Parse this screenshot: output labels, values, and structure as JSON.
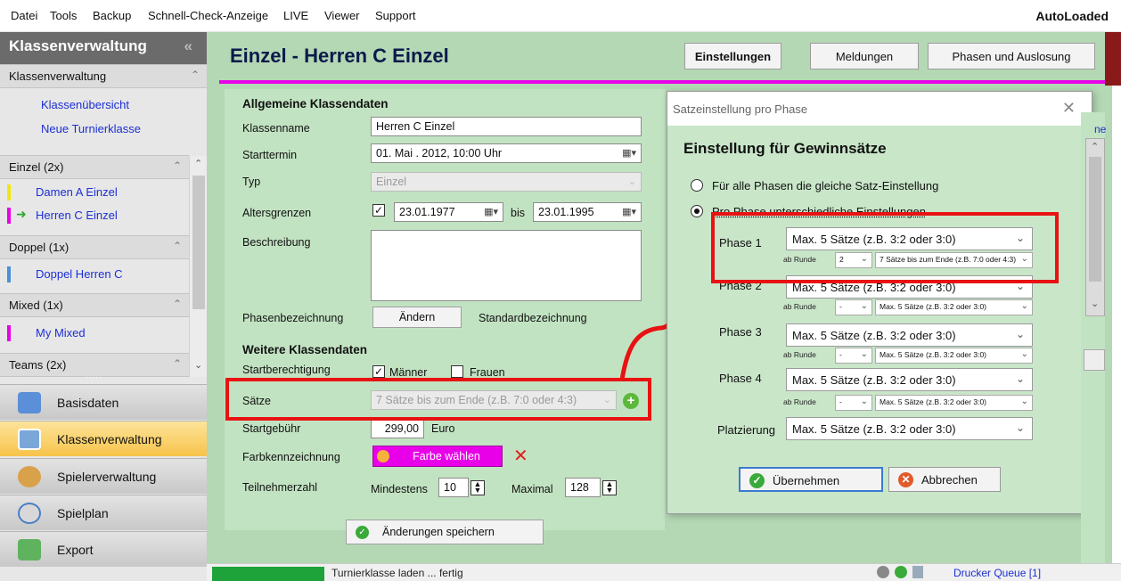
{
  "menu": [
    "Datei",
    "Tools",
    "Backup",
    "Schnell-Check-Anzeige",
    "LIVE",
    "Viewer",
    "Support"
  ],
  "autoloaded": "AutoLoaded",
  "sidebar": {
    "header": "Klassenverwaltung",
    "collapse": "«",
    "sections": [
      {
        "label": "Klassenverwaltung",
        "items": [
          "Klassenübersicht",
          "Neue Turnierklasse"
        ]
      },
      {
        "label": "Einzel (2x)",
        "items": [
          "Damen A Einzel",
          "Herren C Einzel"
        ]
      },
      {
        "label": "Doppel (1x)",
        "items": [
          "Doppel Herren C"
        ]
      },
      {
        "label": "Mixed (1x)",
        "items": [
          "My Mixed"
        ]
      },
      {
        "label": "Teams (2x)",
        "items": []
      }
    ],
    "dots": ".....",
    "nav": [
      "Basisdaten",
      "Klassenverwaltung",
      "Spielerverwaltung",
      "Spielplan",
      "Export"
    ],
    "colors": {
      "damen": "#f0e80c",
      "herren": "#e800e8",
      "doppel": "#4a90d9",
      "mixed": "#e800e8",
      "active_nav": "#fbd66b"
    }
  },
  "main": {
    "title": "Einzel - Herren C Einzel",
    "tabs": [
      "Einstellungen",
      "Meldungen",
      "Phasen und Auslosung"
    ]
  },
  "form": {
    "general_title": "Allgemeine Klassendaten",
    "labels": {
      "klassenname": "Klassenname",
      "starttermin": "Starttermin",
      "typ": "Typ",
      "alter": "Altersgrenzen",
      "bis": "bis",
      "beschreibung": "Beschreibung",
      "phasen": "Phasenbezeichnung",
      "standard": "Standardbezeichnung"
    },
    "values": {
      "klassenname": "Herren C Einzel",
      "starttermin": "01. Mai . 2012, 10:00 Uhr",
      "typ": "Einzel",
      "alter_von": "23.01.1977",
      "alter_bis": "23.01.1995"
    },
    "aendern": "Ändern",
    "weitere_title": "Weitere Klassendaten",
    "labels2": {
      "startber": "Startberechtigung",
      "maenner": "Männer",
      "frauen": "Frauen",
      "saetze": "Sätze",
      "startgebuehr": "Startgebühr",
      "euro": "Euro",
      "farbe": "Farbkennzeichnung",
      "teilnehmer": "Teilnehmerzahl",
      "mindestens": "Mindestens",
      "maximal": "Maximal"
    },
    "values2": {
      "saetze": "7 Sätze bis zum Ende (z.B. 7:0 oder 4:3)",
      "startgebuehr": "299,00",
      "farbe_btn": "Farbe wählen",
      "min": "10",
      "max": "128"
    },
    "save": "Änderungen speichern"
  },
  "dialog": {
    "title": "Satzeinstellung pro Phase",
    "heading": "Einstellung für Gewinnsätze",
    "radio1": "Für alle Phasen die gleiche Satz-Einstellung",
    "radio2": "Pro Phase unterschiedliche Einstellungen",
    "phases": [
      {
        "label": "Phase 1",
        "main": "Max. 5 Sätze (z.B. 3:2 oder 3:0)",
        "ab": "ab Runde",
        "round": "2",
        "sub": "7 Sätze bis zum Ende (z.B. 7:0 oder 4:3)"
      },
      {
        "label": "Phase 2",
        "main": "Max. 5 Sätze (z.B. 3:2 oder 3:0)",
        "ab": "ab Runde",
        "round": "-",
        "sub": "Max. 5 Sätze (z.B. 3:2 oder 3:0)"
      },
      {
        "label": "Phase 3",
        "main": "Max. 5 Sätze (z.B. 3:2 oder 3:0)",
        "ab": "ab Runde",
        "round": "-",
        "sub": "Max. 5 Sätze (z.B. 3:2 oder 3:0)"
      },
      {
        "label": "Phase 4",
        "main": "Max. 5 Sätze (z.B. 3:2 oder 3:0)",
        "ab": "ab Runde",
        "round": "-",
        "sub": "Max. 5 Sätze (z.B. 3:2 oder 3:0)"
      }
    ],
    "placement_label": "Platzierung",
    "placement": "Max. 5 Sätze (z.B. 3:2 oder 3:0)",
    "ok": "Übernehmen",
    "cancel": "Abbrechen",
    "edge_text": "ne"
  },
  "status": {
    "text": "Turnierklasse laden ... fertig",
    "printer": "Drucker Queue [1]"
  }
}
